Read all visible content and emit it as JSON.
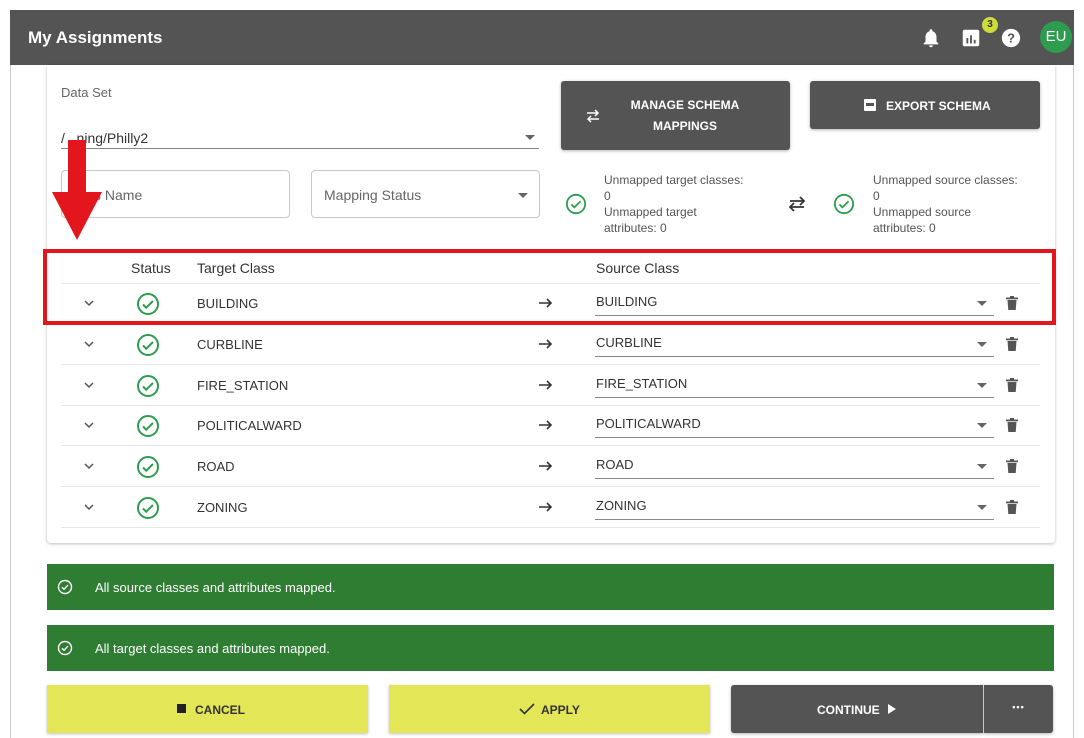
{
  "header": {
    "title": "My Assignments",
    "notification_count": "3",
    "avatar_initials": "EU"
  },
  "dataset": {
    "label": "Data Set",
    "value": "/Training/Philly2",
    "value_visible": "/   ning/Philly2"
  },
  "filters": {
    "class_name_placeholder": "Class Name",
    "class_name_visible": "ss Name",
    "mapping_status_placeholder": "Mapping Status"
  },
  "buttons": {
    "manage_schema_line1": "MANAGE SCHEMA",
    "manage_schema_line2": "MAPPINGS",
    "export_schema": "EXPORT SCHEMA",
    "cancel": "CANCEL",
    "apply": "APPLY",
    "continue": "CONTINUE",
    "more": "•••"
  },
  "stats": {
    "target_classes_label": "Unmapped target classes:",
    "target_classes_value": "0",
    "target_attributes_label1": "Unmapped target",
    "target_attributes_label2": "attributes: 0",
    "source_classes_label": "Unmapped source classes:",
    "source_classes_value": "0",
    "source_attributes_label1": "Unmapped source",
    "source_attributes_label2": "attributes: 0"
  },
  "table": {
    "headers": {
      "status": "Status",
      "target": "Target Class",
      "source": "Source Class"
    },
    "rows": [
      {
        "target": "BUILDING",
        "source": "BUILDING"
      },
      {
        "target": "CURBLINE",
        "source": "CURBLINE"
      },
      {
        "target": "FIRE_STATION",
        "source": "FIRE_STATION"
      },
      {
        "target": "POLITICALWARD",
        "source": "POLITICALWARD"
      },
      {
        "target": "ROAD",
        "source": "ROAD"
      },
      {
        "target": "ZONING",
        "source": "ZONING"
      }
    ]
  },
  "banners": {
    "source_mapped": "All source classes and attributes mapped.",
    "target_mapped": "All target classes and attributes mapped."
  },
  "colors": {
    "header_bg": "#545454",
    "success_green": "#2e7d32",
    "check_green": "#2e9c4e",
    "action_yellow": "#e2e657",
    "highlight_red": "#e3151d"
  }
}
